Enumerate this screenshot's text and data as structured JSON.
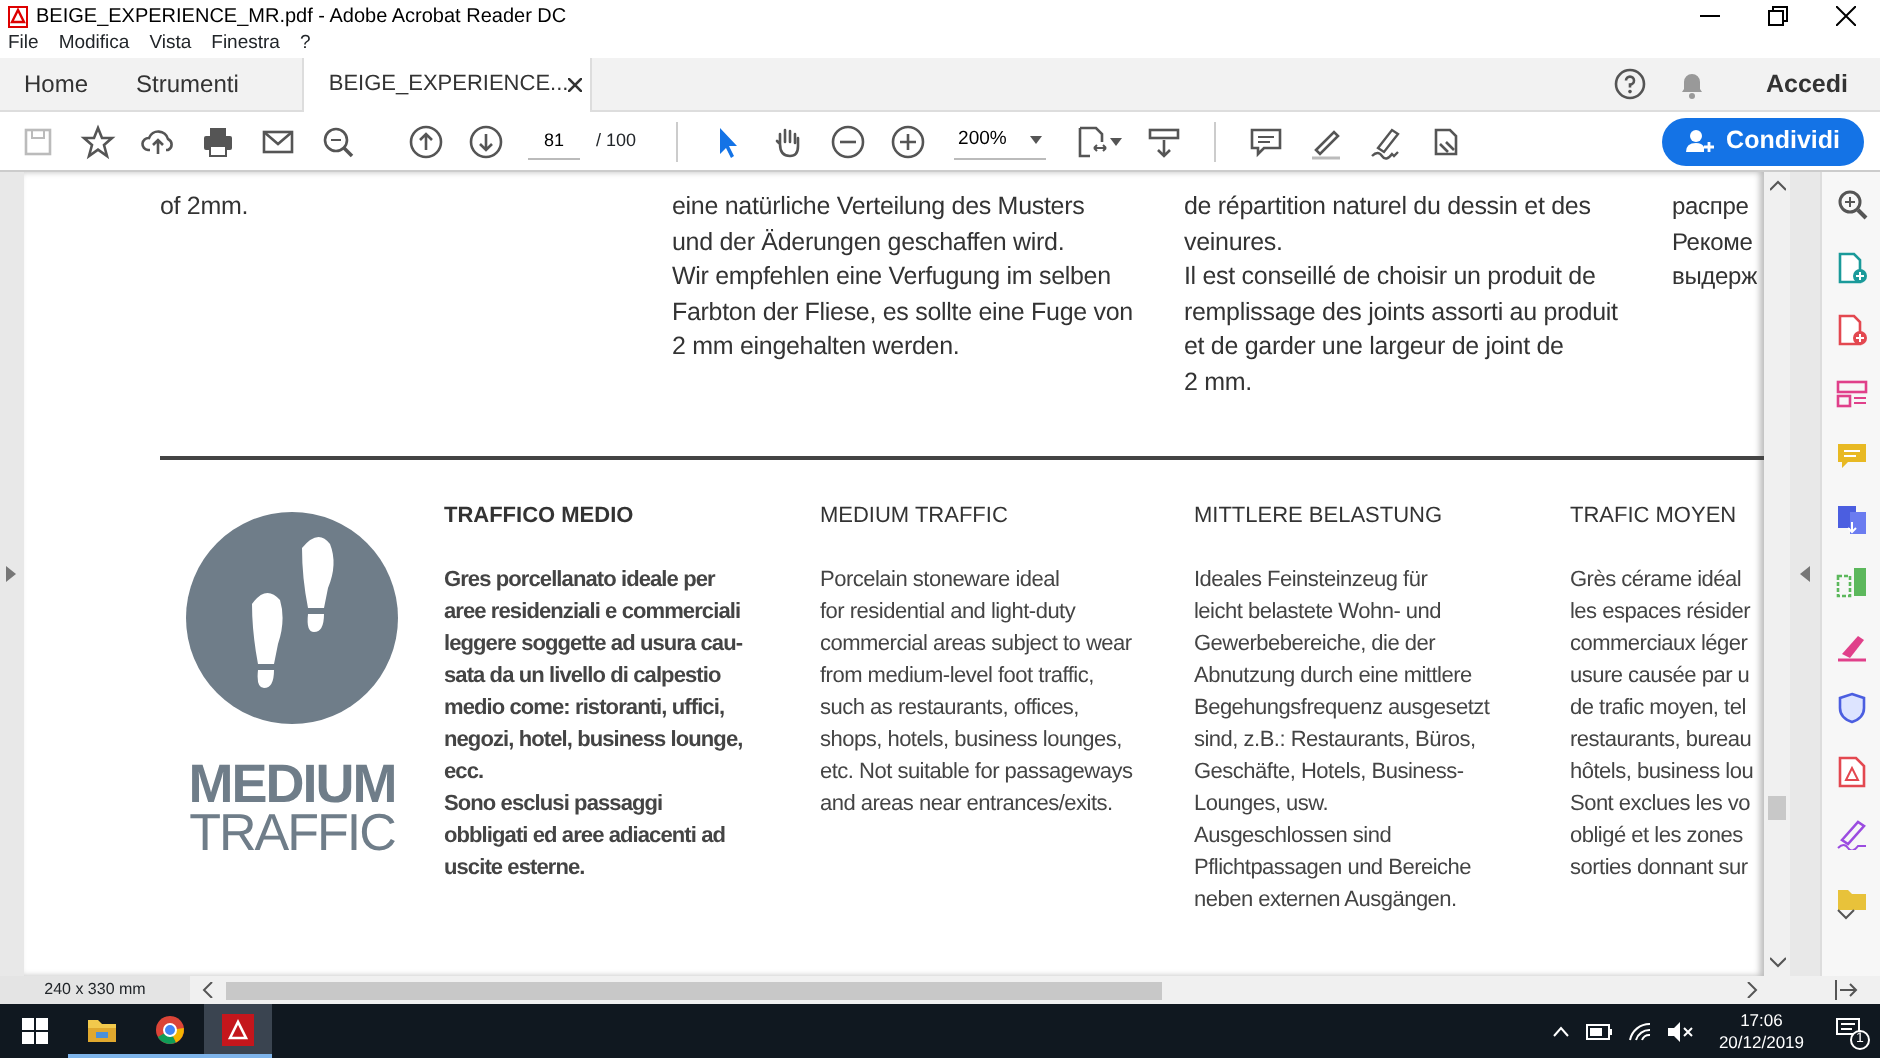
{
  "window": {
    "title": "BEIGE_EXPERIENCE_MR.pdf - Adobe Acrobat Reader DC"
  },
  "menu": [
    "File",
    "Modifica",
    "Vista",
    "Finestra",
    "?"
  ],
  "tabs": [
    {
      "label": "Home",
      "selected": false
    },
    {
      "label": "Strumenti",
      "selected": false
    },
    {
      "label": "BEIGE_EXPERIENCE...",
      "selected": true
    }
  ],
  "account": {
    "label": "Accedi"
  },
  "toolbar": {
    "tools": [
      {
        "kind": "save",
        "disabled": true
      },
      {
        "kind": "bookmark",
        "disabled": false
      },
      {
        "kind": "upload",
        "disabled": false
      },
      {
        "kind": "print",
        "disabled": false
      },
      {
        "kind": "email",
        "disabled": false
      },
      {
        "kind": "find",
        "disabled": false
      },
      {
        "kind": "prev",
        "disabled": false
      },
      {
        "kind": "next",
        "disabled": false
      },
      {
        "kind": "page",
        "value": "81",
        "total": "/ 100"
      },
      {
        "kind": "pointer",
        "disabled": false,
        "selected": true
      },
      {
        "kind": "hand",
        "disabled": false,
        "selected": false
      },
      {
        "kind": "zoom-out",
        "disabled": false
      },
      {
        "kind": "zoom-in",
        "disabled": false
      },
      {
        "kind": "zoom",
        "value": "200%"
      },
      {
        "kind": "fit",
        "disabled": false
      },
      {
        "kind": "scroll",
        "disabled": false
      },
      {
        "kind": "comment",
        "disabled": false
      },
      {
        "kind": "highlight",
        "disabled": false
      },
      {
        "kind": "sign",
        "disabled": false
      },
      {
        "kind": "stamp",
        "disabled": false
      }
    ],
    "share": "Condividi"
  },
  "document": {
    "top_columns": [
      {
        "text": "of 2mm."
      },
      {
        "text": "eine natürliche Verteilung des Musters\nund der Äderungen geschaffen wird.\nWir empfehlen eine Verfugung im selben\nFarbton der Fliese, es sollte eine Fuge von\n2 mm eingehalten werden."
      },
      {
        "text": "de répartition naturel du dessin et des\nveinures.\nIl est conseillé de choisir un produit de\nremplissage des joints assorti au produit\net de garder une largeur de joint de\n2 mm."
      },
      {
        "text": "распре\nРекоме\nвыдерж"
      }
    ],
    "badge": {
      "title": "MEDIUM",
      "subtitle": "TRAFFIC"
    },
    "feature_columns": [
      {
        "heading": "TRAFFICO MEDIO",
        "emphasis": true,
        "text": "Gres porcellanato ideale per\naree residenziali e commerciali\nleggere soggette ad usura cau-\nsata da un livello di calpestio\nmedio come: ristoranti, uffici,\nnegozi, hotel, business lounge,\necc.\nSono esclusi passaggi\nobbligati ed aree adiacenti ad\nuscite esterne."
      },
      {
        "heading": "MEDIUM TRAFFIC",
        "emphasis": false,
        "text": "Porcelain stoneware ideal\nfor residential and light-duty\ncommercial areas subject to wear\nfrom medium-level foot traffic,\nsuch as restaurants, offices,\nshops, hotels, business lounges,\netc. Not suitable for passageways\nand areas near entrances/exits."
      },
      {
        "heading": "MITTLERE BELASTUNG",
        "emphasis": false,
        "text": "Ideales Feinsteinzeug für\nleicht belastete Wohn- und\nGewerbebereiche, die der\nAbnutzung durch eine mittlere\nBegehungsfrequenz ausgesetzt\nsind, z.B.: Restaurants, Büros,\nGeschäfte, Hotels, Business-\nLounges, usw.\nAusgeschlossen sind\nPflichtpassagen und Bereiche\nneben externen Ausgängen."
      },
      {
        "heading": "TRAFIC MOYEN",
        "emphasis": false,
        "text": "Grès cérame idéal\nles espaces résider\ncommerciaux léger\nusure causée par u\nde trafic moyen, tel\nrestaurants, bureau\nhôtels, business lou\nSont exclues les vo\nobligé et les zones\nsorties donnant sur"
      }
    ]
  },
  "side_tools": [
    {
      "kind": "zoom"
    },
    {
      "kind": "create"
    },
    {
      "kind": "export"
    },
    {
      "kind": "organize"
    },
    {
      "kind": "comment"
    },
    {
      "kind": "convert"
    },
    {
      "kind": "compress"
    },
    {
      "kind": "fill"
    },
    {
      "kind": "protect"
    },
    {
      "kind": "pdf"
    },
    {
      "kind": "sign"
    },
    {
      "kind": "more"
    }
  ],
  "status": {
    "page_size": "240 x 330 mm"
  },
  "taskbar": {
    "apps": [
      {
        "kind": "folder",
        "selected": false
      },
      {
        "kind": "browser",
        "selected": false
      },
      {
        "kind": "acrobat",
        "selected": true
      }
    ],
    "time": "17:06",
    "date": "20/12/2019",
    "notifications": "1"
  }
}
